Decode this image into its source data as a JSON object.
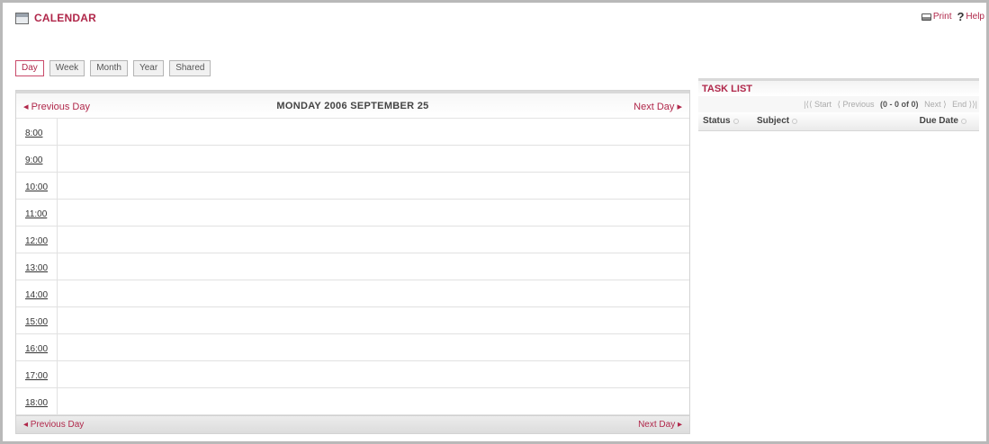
{
  "app": {
    "title": "CALENDAR",
    "print": "Print",
    "help": "Help"
  },
  "views": [
    {
      "label": "Day",
      "active": true
    },
    {
      "label": "Week"
    },
    {
      "label": "Month"
    },
    {
      "label": "Year"
    },
    {
      "label": "Shared"
    }
  ],
  "day_nav": {
    "prev": "◂ Previous Day",
    "next": "Next Day ▸",
    "title": "MONDAY 2006 SEPTEMBER 25"
  },
  "hours": [
    "8:00",
    "9:00",
    "10:00",
    "11:00",
    "12:00",
    "13:00",
    "14:00",
    "15:00",
    "16:00",
    "17:00",
    "18:00"
  ],
  "bottom_nav": {
    "prev": "◂ Previous Day",
    "next": "Next Day ▸"
  },
  "task_list": {
    "title": "TASK LIST",
    "pager": {
      "start": "|⟨⟨ Start",
      "previous": "⟨ Previous",
      "range": "(0 - 0 of 0)",
      "next": "Next ⟩",
      "end": "End ⟩⟩|"
    },
    "columns": {
      "status": "Status",
      "subject": "Subject",
      "due_date": "Due Date"
    }
  }
}
